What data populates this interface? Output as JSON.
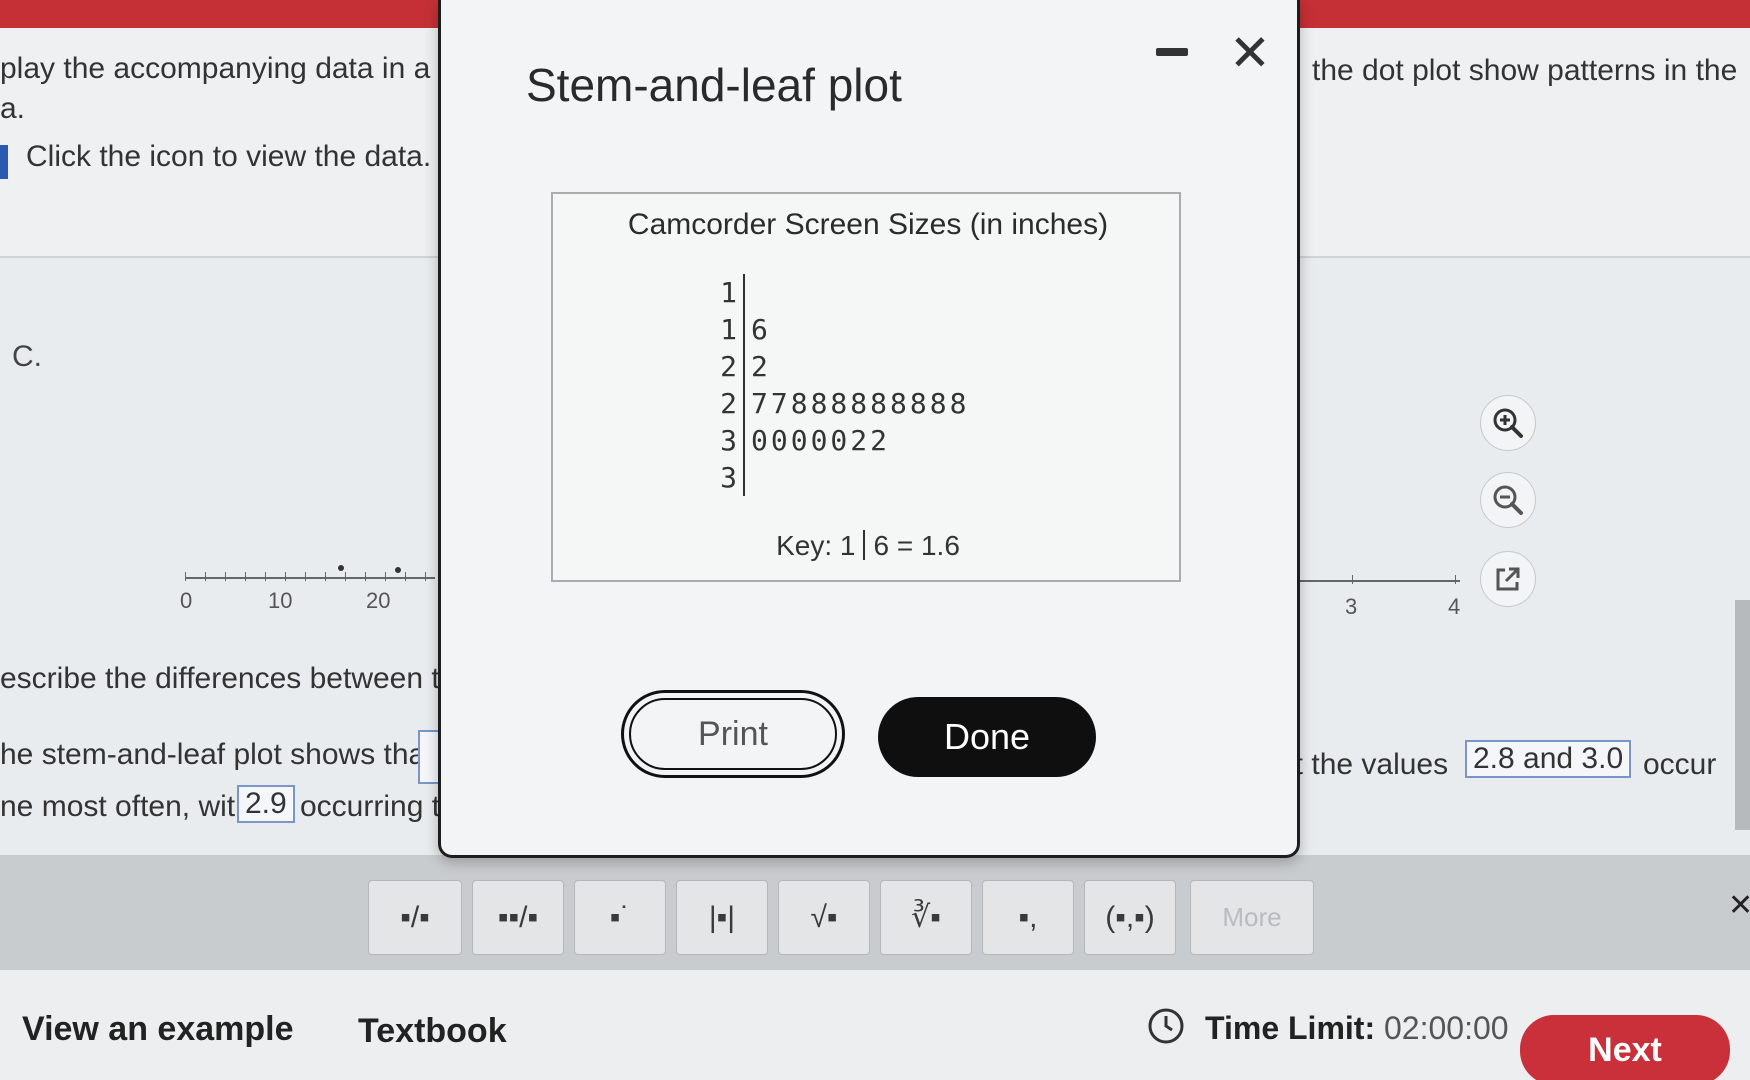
{
  "background": {
    "question_line_1": "play the accompanying data in a",
    "question_line_2": "a.",
    "data_link": "Click the icon to view the data.",
    "right_question_text": "the dot plot show patterns in the",
    "option_label": "C.",
    "left_axis_ticks": [
      "0",
      "10",
      "20"
    ],
    "right_axis_ticks": [
      "3",
      "4"
    ],
    "describe_text": "escribe the differences between the",
    "answer_line_1_start": "he stem-and-leaf plot shows that",
    "answer_line_1_right": "at the values",
    "answer_value_1": "2.8 and 3.0",
    "answer_line_1_end": "occur",
    "answer_line_2_start": "ne most often, with",
    "answer_value_2": "2.9",
    "answer_line_2_end": "occurring th"
  },
  "toolbar": {
    "buttons": [
      "fraction",
      "mixed-number",
      "exponent",
      "absolute-value",
      "square-root",
      "nth-root",
      "subscript",
      "ordered-pair"
    ],
    "glyphs": [
      "▪/▪",
      "▪▪/▪",
      "▪˙",
      "|▪|",
      "√▪",
      "∛▪",
      "▪,",
      "(▪,▪)"
    ],
    "more_label": "More"
  },
  "bottom": {
    "view_example": "View an example",
    "textbook": "Textbook",
    "time_limit_label": "Time Limit:",
    "time_limit_value": "02:00:00",
    "next_label": "Next"
  },
  "modal": {
    "title": "Stem-and-leaf plot",
    "minimize_icon": "minimize-icon",
    "close_glyph": "✕",
    "print_label": "Print",
    "done_label": "Done"
  },
  "chart_data": {
    "type": "table",
    "title": "Camcorder Screen Sizes (in inches)",
    "rows": [
      {
        "stem": "1",
        "leaves": ""
      },
      {
        "stem": "1",
        "leaves": "6"
      },
      {
        "stem": "2",
        "leaves": "2"
      },
      {
        "stem": "2",
        "leaves": "77888888888"
      },
      {
        "stem": "3",
        "leaves": "0000022"
      },
      {
        "stem": "3",
        "leaves": ""
      }
    ],
    "key_prefix": "Key: 1",
    "key_suffix": "6 = 1.6"
  },
  "colors": {
    "accent_red": "#c9303a",
    "link_blue": "#2a5ab0"
  }
}
